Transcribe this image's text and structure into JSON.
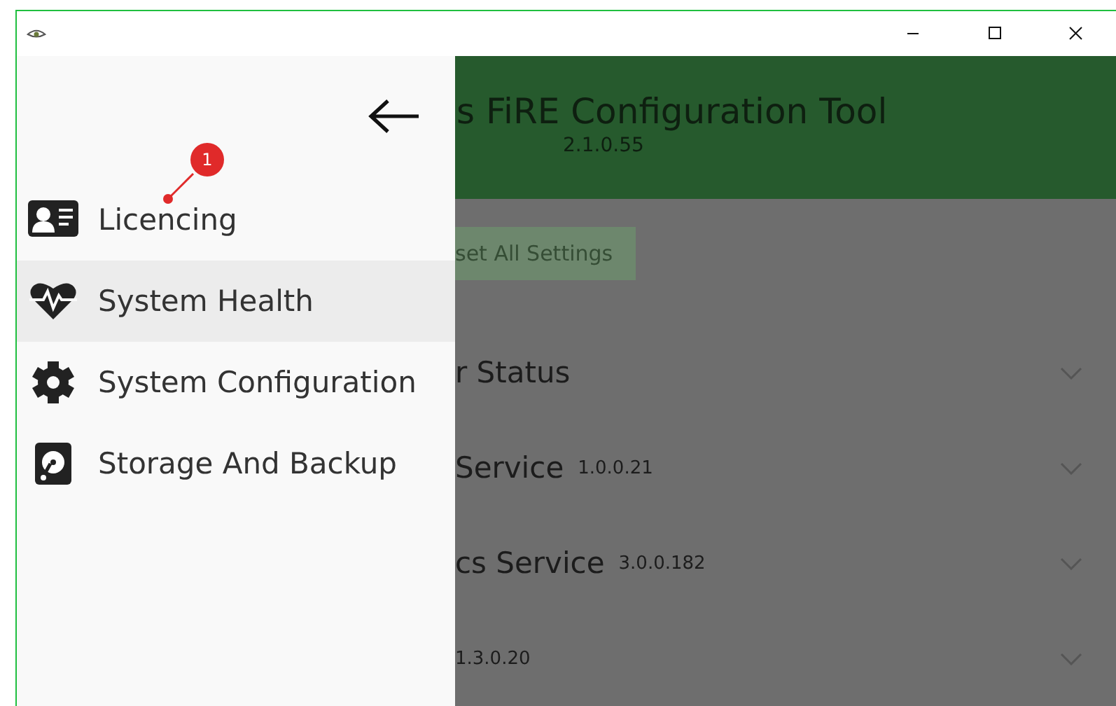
{
  "window": {
    "controls": [
      {
        "kind": "minimize"
      },
      {
        "kind": "maximize"
      },
      {
        "kind": "close"
      }
    ]
  },
  "drawer": {
    "items": [
      {
        "label": "Licencing",
        "selected": false
      },
      {
        "label": "System Health",
        "selected": true
      },
      {
        "label": "System Configuration",
        "selected": false
      },
      {
        "label": "Storage And Backup",
        "selected": false
      }
    ]
  },
  "annotation": {
    "badge": "1"
  },
  "header": {
    "title": "s FiRE Configuration Tool",
    "version": "2.1.0.55"
  },
  "reset_button": {
    "label": "set All Settings"
  },
  "sections": [
    {
      "title": "r Status",
      "expanded": false
    },
    {
      "title": "Service",
      "version": "1.0.0.21",
      "expanded": false
    },
    {
      "title": "cs Service",
      "version": "3.0.0.182",
      "expanded": false
    },
    {
      "version": "1.3.0.20",
      "expanded": false
    }
  ]
}
